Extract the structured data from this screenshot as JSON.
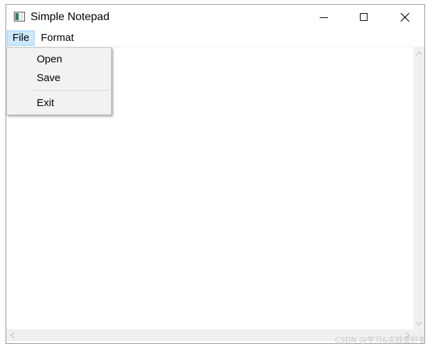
{
  "window": {
    "title": "Simple Notepad",
    "icon": "notepad-app-icon",
    "controls": {
      "minimize_icon": "minimize-icon",
      "maximize_icon": "maximize-icon",
      "close_icon": "close-icon"
    }
  },
  "menubar": {
    "items": [
      {
        "label": "File",
        "active": true
      },
      {
        "label": "Format",
        "active": false
      }
    ]
  },
  "file_menu": {
    "items": [
      "Open",
      "Save",
      "Exit"
    ]
  },
  "editor": {
    "content": ""
  },
  "watermark": "CSDN @学习&实践爱好者",
  "colors": {
    "menu_highlight": "#cce8ff",
    "menu_highlight_border": "#99d1ff",
    "dropdown_bg": "#f2f2f2",
    "scrollbar_bg": "#f0f0f0"
  }
}
